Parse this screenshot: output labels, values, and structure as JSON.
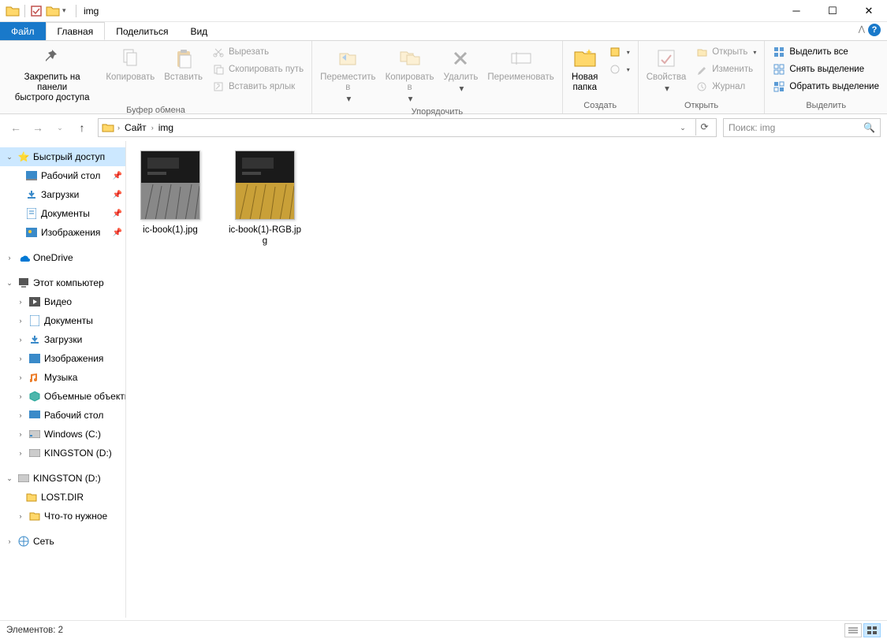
{
  "window": {
    "title": "img"
  },
  "tabs": {
    "file": "Файл",
    "home": "Главная",
    "share": "Поделиться",
    "view": "Вид"
  },
  "ribbon": {
    "clipboard": {
      "pin": "Закрепить на панели\nбыстрого доступа",
      "copy": "Копировать",
      "paste": "Вставить",
      "cut": "Вырезать",
      "copypath": "Скопировать путь",
      "pasteshortcut": "Вставить ярлык",
      "label": "Буфер обмена"
    },
    "organize": {
      "moveto": "Переместить\nв",
      "copyto": "Копировать\nв",
      "delete": "Удалить",
      "rename": "Переименовать",
      "label": "Упорядочить"
    },
    "new": {
      "newfolder": "Новая\nпапка",
      "label": "Создать"
    },
    "open": {
      "properties": "Свойства",
      "open": "Открыть",
      "edit": "Изменить",
      "history": "Журнал",
      "label": "Открыть"
    },
    "select": {
      "selectall": "Выделить все",
      "selectnone": "Снять выделение",
      "invert": "Обратить выделение",
      "label": "Выделить"
    }
  },
  "address": {
    "crumbs": [
      "Сайт",
      "img"
    ],
    "search_placeholder": "Поиск: img"
  },
  "tree": {
    "quick": "Быстрый доступ",
    "desktop": "Рабочий стол",
    "downloads": "Загрузки",
    "documents": "Документы",
    "pictures": "Изображения",
    "onedrive": "OneDrive",
    "thispc": "Этот компьютер",
    "video": "Видео",
    "documents2": "Документы",
    "downloads2": "Загрузки",
    "pictures2": "Изображения",
    "music": "Музыка",
    "objects3d": "Объемные объекты",
    "desktop2": "Рабочий стол",
    "windowsc": "Windows (C:)",
    "kingstond": "KINGSTON (D:)",
    "kingstond2": "KINGSTON (D:)",
    "lostdir": "LOST.DIR",
    "something": "Что-то нужное",
    "network": "Сеть"
  },
  "files": [
    {
      "name": "ic-book(1).jpg",
      "variant": "bw"
    },
    {
      "name": "ic-book(1)-RGB.jpg",
      "variant": "color"
    }
  ],
  "status": {
    "items": "Элементов: 2"
  }
}
